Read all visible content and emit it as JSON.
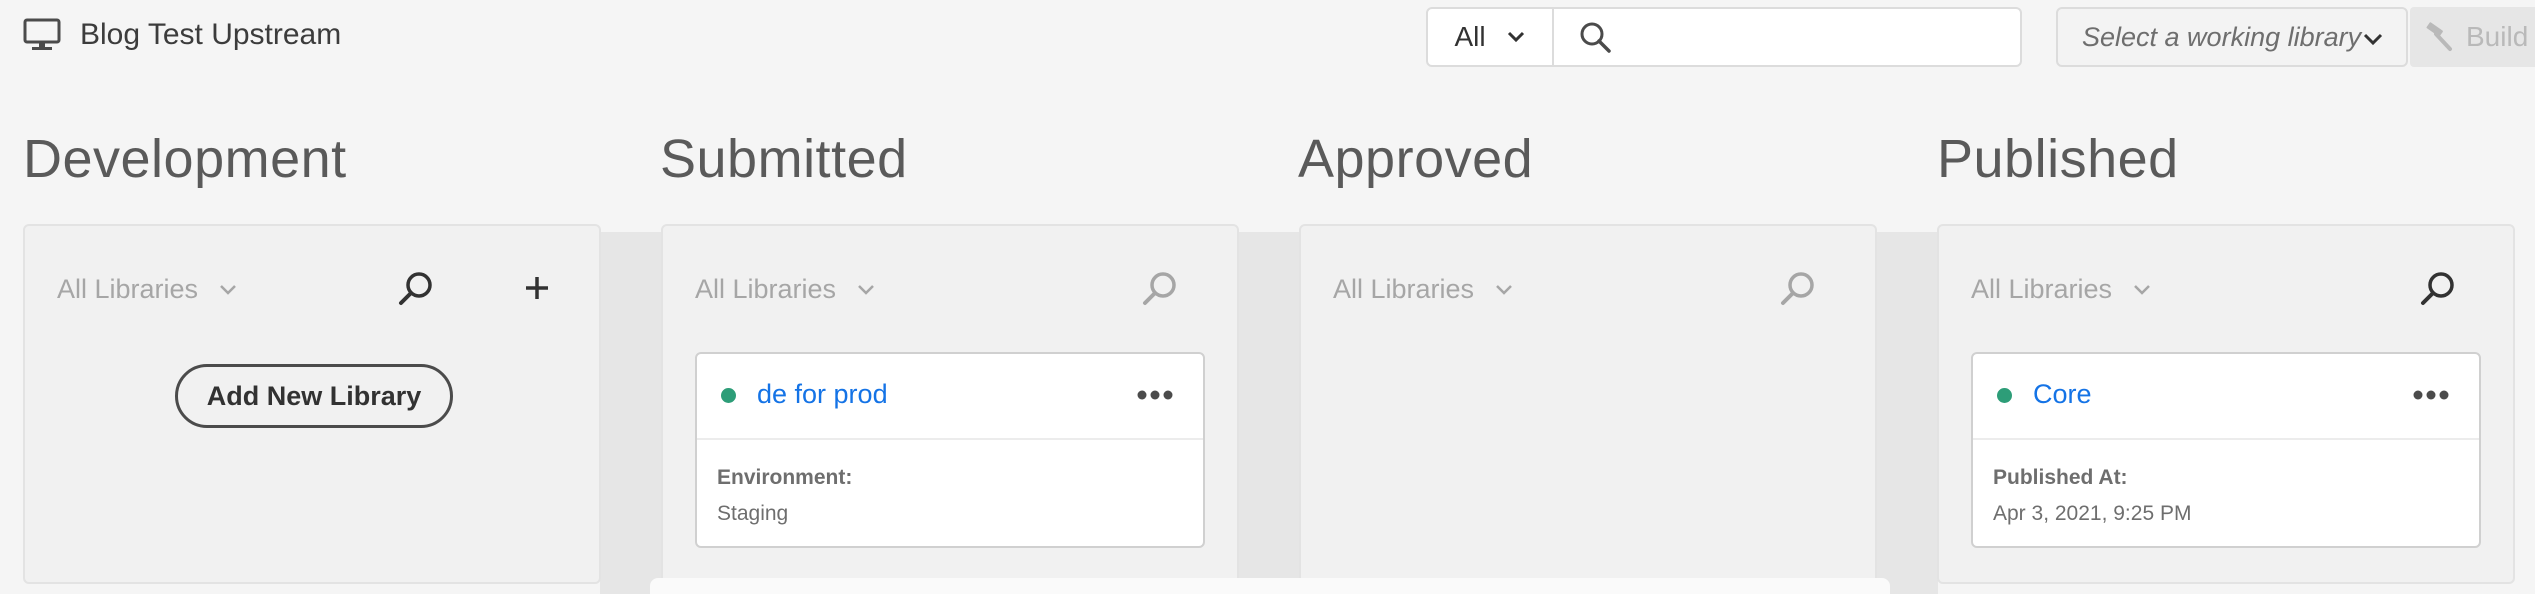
{
  "header": {
    "property_name": "Blog Test Upstream",
    "property_icon": "monitor-icon",
    "search_scope": "All",
    "search_placeholder": "",
    "working_library_placeholder": "Select a working library",
    "build_label": "Build"
  },
  "columns": [
    {
      "title": "Development",
      "filter": "All Libraries",
      "add_label": "Add New Library"
    },
    {
      "title": "Submitted",
      "filter": "All Libraries",
      "card": {
        "name": "de for prod",
        "status_color": "#2d9d78",
        "label": "Environment:",
        "value": "Staging"
      }
    },
    {
      "title": "Approved",
      "filter": "All Libraries"
    },
    {
      "title": "Published",
      "filter": "All Libraries",
      "card": {
        "name": "Core",
        "status_color": "#2d9d78",
        "label": "Published At:",
        "value": "Apr 3, 2021, 9:25 PM"
      }
    }
  ],
  "colors": {
    "link": "#1473e6",
    "status_active": "#2d9d78",
    "background": "#f5f5f5"
  }
}
